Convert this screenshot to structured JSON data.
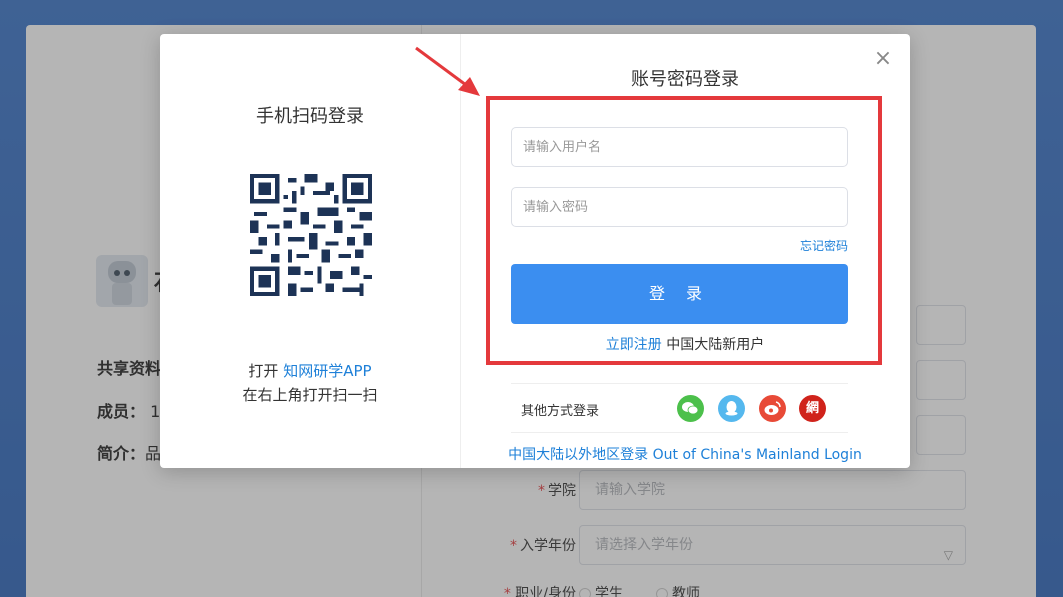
{
  "background": {
    "group_initial": "石",
    "info": [
      {
        "label": "共享资料",
        "value": ""
      },
      {
        "label": "成员：",
        "value": "1"
      },
      {
        "label": "简介：",
        "value": "品"
      }
    ],
    "form": {
      "college_label": "学院",
      "college_placeholder": "请输入学院",
      "year_label": "入学年份",
      "year_placeholder": "请选择入学年份",
      "role_label": "职业/身份",
      "role_options": [
        "学生",
        "教师"
      ]
    }
  },
  "modal": {
    "qr": {
      "title": "手机扫码登录",
      "hint_prefix": "打开",
      "hint_app": "知网研学APP",
      "hint_line2": "在右上角打开扫一扫"
    },
    "login": {
      "title": "账号密码登录",
      "username_placeholder": "请输入用户名",
      "password_placeholder": "请输入密码",
      "forgot_label": "忘记密码",
      "login_button": "登 录",
      "register_link": "立即注册",
      "register_note": "中国大陆新用户",
      "other_label": "其他方式登录",
      "social": [
        {
          "name": "wechat",
          "color": "#4cc04b"
        },
        {
          "name": "qq",
          "color": "#55b8ee"
        },
        {
          "name": "weibo",
          "color": "#e84a37"
        },
        {
          "name": "cnki",
          "color": "#d0231b",
          "glyph": "網"
        }
      ],
      "abroad_link": "中国大陆以外地区登录 Out of China's Mainland Login"
    },
    "close_icon": "×"
  },
  "colors": {
    "accent": "#3b8ef0",
    "link": "#1e80d8",
    "highlight": "#e4393c"
  }
}
